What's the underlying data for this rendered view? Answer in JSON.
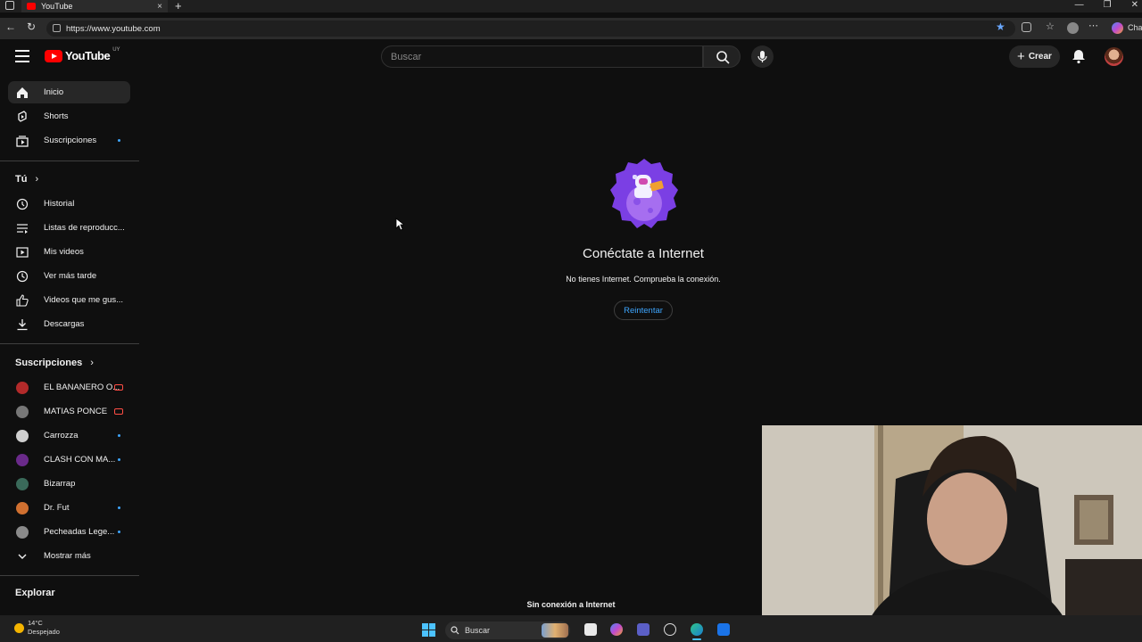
{
  "browser": {
    "tab_title": "YouTube",
    "url": "https://www.youtube.com",
    "new_tab": "+",
    "close_tab": "×",
    "copilot_label": "Cha"
  },
  "masthead": {
    "logo_text": "YouTube",
    "logo_country": "UY",
    "search_placeholder": "Buscar",
    "create_label": "Crear"
  },
  "sidebar": {
    "main": [
      {
        "label": "Inicio",
        "icon": "home-icon"
      },
      {
        "label": "Shorts",
        "icon": "shorts-icon"
      },
      {
        "label": "Suscripciones",
        "icon": "subscriptions-icon"
      }
    ],
    "you_header": "Tú",
    "you": [
      {
        "label": "Historial",
        "icon": "history-icon"
      },
      {
        "label": "Listas de reproducc...",
        "icon": "playlist-icon"
      },
      {
        "label": "Mis videos",
        "icon": "my-videos-icon"
      },
      {
        "label": "Ver más tarde",
        "icon": "watch-later-icon"
      },
      {
        "label": "Videos que me gus...",
        "icon": "like-icon"
      },
      {
        "label": "Descargas",
        "icon": "download-icon"
      }
    ],
    "subs_header": "Suscripciones",
    "subscriptions": [
      {
        "label": "EL BANANERO O...",
        "color": "#b22a2a",
        "indicator": "live"
      },
      {
        "label": "MATIAS PONCE",
        "color": "#777777",
        "indicator": "live"
      },
      {
        "label": "Carrozza",
        "color": "#cfcfcf",
        "indicator": "dot"
      },
      {
        "label": "CLASH CON MA...",
        "color": "#6a2a8a",
        "indicator": "dot"
      },
      {
        "label": "Bizarrap",
        "color": "#3a6a5a",
        "indicator": "none"
      },
      {
        "label": "Dr. Fut",
        "color": "#d07030",
        "indicator": "dot"
      },
      {
        "label": "Pecheadas Lege...",
        "color": "#8a8a8a",
        "indicator": "dot"
      }
    ],
    "show_more": "Mostrar más",
    "explore_header": "Explorar"
  },
  "main": {
    "title": "Conéctate a Internet",
    "subtitle": "No tienes Internet. Comprueba la conexión.",
    "retry_label": "Reintentar",
    "offline_toast": "Sin conexión a Internet"
  },
  "taskbar": {
    "temperature": "14°C",
    "weather": "Despejado",
    "search_label": "Buscar"
  },
  "colors": {
    "accent_blue": "#3ea6ff",
    "youtube_red": "#ff0000",
    "background": "#0f0f0f"
  }
}
